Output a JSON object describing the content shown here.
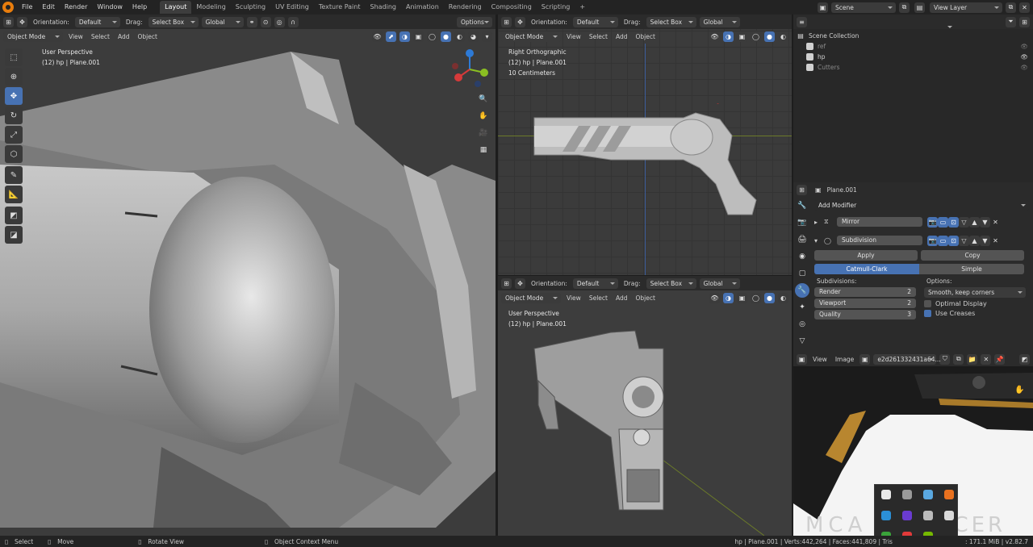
{
  "menus": [
    "File",
    "Edit",
    "Render",
    "Window",
    "Help"
  ],
  "workspaces": [
    {
      "label": "Layout",
      "active": true
    },
    {
      "label": "Modeling",
      "active": false
    },
    {
      "label": "Sculpting",
      "active": false
    },
    {
      "label": "UV Editing",
      "active": false
    },
    {
      "label": "Texture Paint",
      "active": false
    },
    {
      "label": "Shading",
      "active": false
    },
    {
      "label": "Animation",
      "active": false
    },
    {
      "label": "Rendering",
      "active": false
    },
    {
      "label": "Compositing",
      "active": false
    },
    {
      "label": "Scripting",
      "active": false
    }
  ],
  "add_tab": "+",
  "scene": {
    "label": "Scene",
    "view_layer": "View Layer"
  },
  "vp_header": {
    "orientation_label": "Orientation:",
    "orientation": "Default",
    "drag_label": "Drag:",
    "drag": "Select Box",
    "transform": "Global",
    "options": "Options",
    "mode": "Object Mode",
    "view": "View",
    "select": "Select",
    "add": "Add",
    "object": "Object"
  },
  "viewport_main": {
    "title": "User Perspective",
    "sub": "(12) hp | Plane.001"
  },
  "viewport_right": {
    "title": "Right Orthographic",
    "sub": "(12) hp | Plane.001",
    "scale": "10 Centimeters"
  },
  "viewport_bottom": {
    "title": "User Perspective",
    "sub": "(12) hp | Plane.001"
  },
  "outliner": {
    "root": "Scene Collection",
    "items": [
      {
        "label": "ref",
        "checked": true
      },
      {
        "label": "hp",
        "checked": true
      },
      {
        "label": "Cutters",
        "checked": true
      }
    ]
  },
  "properties": {
    "object": "Plane.001",
    "add_modifier": "Add Modifier",
    "mirror": "Mirror",
    "subdivision": "Subdivision",
    "apply": "Apply",
    "copy": "Copy",
    "catmull": "Catmull-Clark",
    "simple": "Simple",
    "subdivisions_label": "Subdivisions:",
    "options_label": "Options:",
    "render_label": "Render",
    "render_val": "2",
    "viewport_label": "Viewport",
    "viewport_val": "2",
    "quality_label": "Quality",
    "quality_val": "3",
    "smooth": "Smooth, keep corners",
    "optimal": "Optimal Display",
    "creases": "Use Creases"
  },
  "image_editor": {
    "view": "View",
    "image": "Image",
    "name": "e2d261332431a64..."
  },
  "status": {
    "select": "Select",
    "move": "Move",
    "rotate": "Rotate View",
    "context": "Object Context Menu",
    "stats": "hp | Plane.001 | Verts:442,264 | Faces:441,809 | Tris",
    "memory": ": 171.1 MiB | v2.82.7"
  },
  "colors": {
    "accent": "#4772b3",
    "bg": "#1d1d1d",
    "panel": "#2b2b2b"
  }
}
